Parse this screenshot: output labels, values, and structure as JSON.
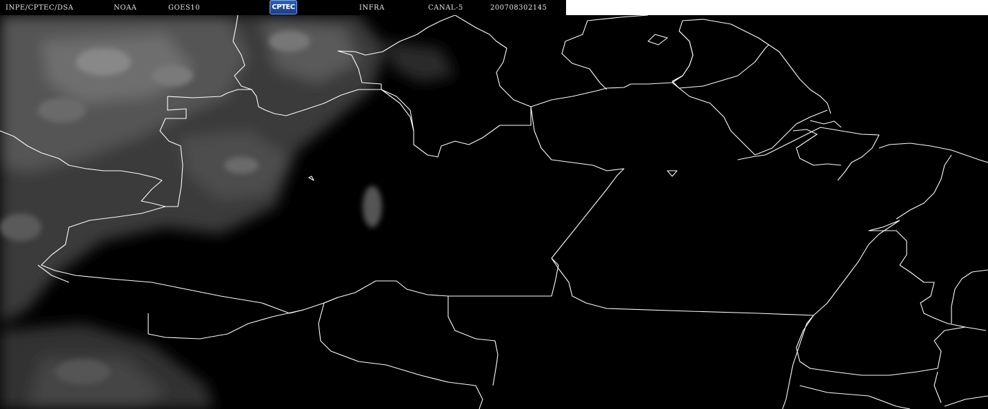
{
  "header": {
    "institution": "INPE/CPTEC/DSA",
    "agency": "NOAA",
    "satellite": "GOES10",
    "logo_text": "CPTEC",
    "product": "INFRA",
    "channel": "CANAL-5",
    "timestamp": "200708302145"
  },
  "colors": {
    "background": "#000000",
    "borders": "#ffffff",
    "clouds": "#8a8a8a",
    "header_text": "#e6e6e6",
    "logo": "#2d5fb3"
  },
  "icons": {
    "logo": "cptec-logo"
  }
}
